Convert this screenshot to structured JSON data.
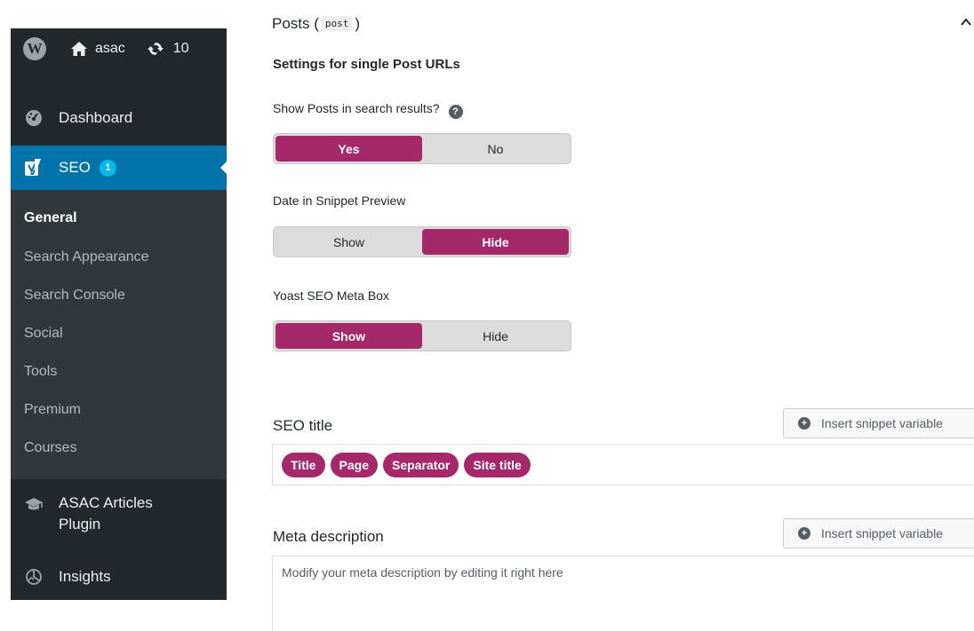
{
  "adminbar": {
    "site_name": "asac",
    "update_count": "10"
  },
  "menu": {
    "dashboard": "Dashboard",
    "seo": {
      "label": "SEO",
      "badge": "1"
    },
    "submenu": [
      "General",
      "Search Appearance",
      "Search Console",
      "Social",
      "Tools",
      "Premium",
      "Courses"
    ],
    "asac_line1": "ASAC Articles",
    "asac_line2": "Plugin",
    "insights": "Insights"
  },
  "section": {
    "title_prefix": "Posts (",
    "title_code": "post",
    "title_suffix": ")",
    "heading": "Settings for single Post URLs"
  },
  "settings": {
    "show_in_search": {
      "label": "Show Posts in search results?",
      "help": "?",
      "options": [
        "Yes",
        "No"
      ],
      "selected": "Yes"
    },
    "date_in_preview": {
      "label": "Date in Snippet Preview",
      "options": [
        "Show",
        "Hide"
      ],
      "selected": "Hide"
    },
    "meta_box": {
      "label": "Yoast SEO Meta Box",
      "options": [
        "Show",
        "Hide"
      ],
      "selected": "Show"
    }
  },
  "seo_title": {
    "label": "SEO title",
    "insert_button": "Insert snippet variable",
    "pills": [
      "Title",
      "Page",
      "Separator",
      "Site title"
    ]
  },
  "meta_description": {
    "label": "Meta description",
    "insert_button": "Insert snippet variable",
    "placeholder": "Modify your meta description by editing it right here"
  },
  "colors": {
    "admin_bg": "#23282d",
    "submenu_bg": "#32373c",
    "seo_active": "#0073aa",
    "badge": "#00b9eb",
    "yoast_accent": "#a4286a"
  }
}
